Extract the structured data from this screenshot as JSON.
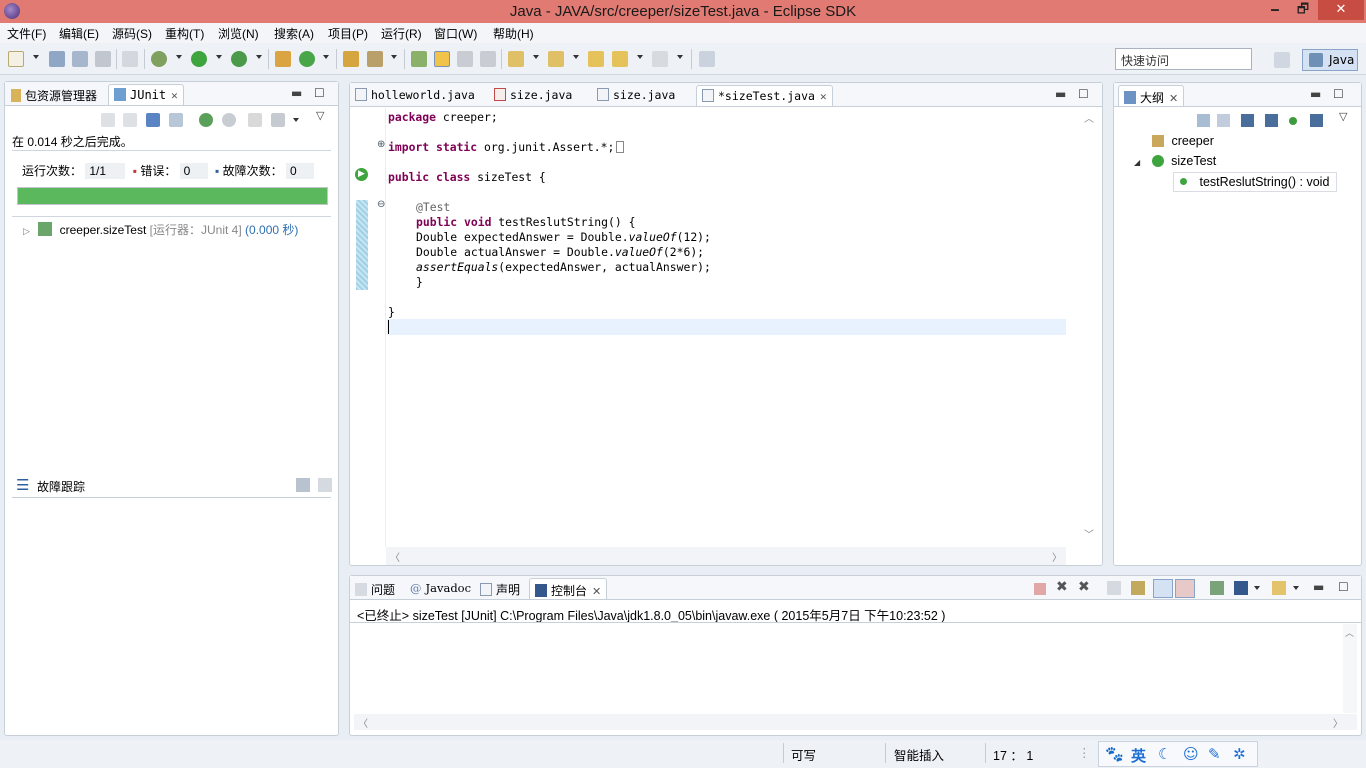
{
  "window": {
    "title": "Java  -  JAVA/src/creeper/sizeTest.java  -  Eclipse SDK",
    "minimize": "🗕",
    "maximize": "🗗",
    "close": "✕"
  },
  "menu": [
    "文件(F)",
    "编辑(E)",
    "源码(S)",
    "重构(T)",
    "浏览(N)",
    "搜索(A)",
    "项目(P)",
    "运行(R)",
    "窗口(W)",
    "帮助(H)"
  ],
  "toolbar": {
    "quick_access_placeholder": "快速访问",
    "perspective": "Java"
  },
  "left_panel": {
    "tabs": [
      "包资源管理器",
      "JUnit"
    ],
    "status": "在 0.014 秒之后完成。",
    "runs_label": "运行次数：",
    "runs_value": "1/1",
    "errors_label": "错误：",
    "errors_value": "0",
    "failures_label": "故障次数：",
    "failures_value": "0",
    "progress": 1.0,
    "progress_color": "#5cb85c",
    "tree": {
      "name": "creeper.sizeTest",
      "runner": "[运行器：JUnit 4]",
      "time": "(0.000 秒)"
    },
    "failure_trace_title": "故障跟踪"
  },
  "editor": {
    "tabs": [
      "holleworld.java",
      "size.java",
      "size.java",
      "*sizeTest.java"
    ],
    "active_tab": 3,
    "code": {
      "l1_kw": "package",
      "l1_rest": " creeper;",
      "l2_kw": "import static",
      "l2_rest": " org.junit.Assert.*;",
      "l3_kw": "public class",
      "l3_rest": " sizeTest {",
      "l4": "@Test",
      "l5_kw": "public void",
      "l5_rest": " testReslutString() {",
      "l6_a": "Double expectedAnswer = Double.",
      "l6_i": "valueOf",
      "l6_b": "(12);",
      "l7_a": "Double actualAnswer = Double.",
      "l7_i": "valueOf",
      "l7_b": "(2*6);",
      "l8_i": "assertEquals",
      "l8_b": "(expectedAnswer, actualAnswer);",
      "l9": "}",
      "l10": "}"
    }
  },
  "outline": {
    "tab": "大纲",
    "package": "creeper",
    "class": "sizeTest",
    "method": "testReslutString() : void"
  },
  "console": {
    "tabs": [
      "问题",
      "Javadoc",
      "声明",
      "控制台"
    ],
    "status": "<已终止> sizeTest [JUnit] C:\\Program Files\\Java\\jdk1.8.0_05\\bin\\javaw.exe ( 2015年5月7日 下午10:23:52 )"
  },
  "statusbar": {
    "writable": "可写",
    "insert_mode": "智能插入",
    "position": "17 ： 1"
  },
  "ime": {
    "lang": "英"
  }
}
